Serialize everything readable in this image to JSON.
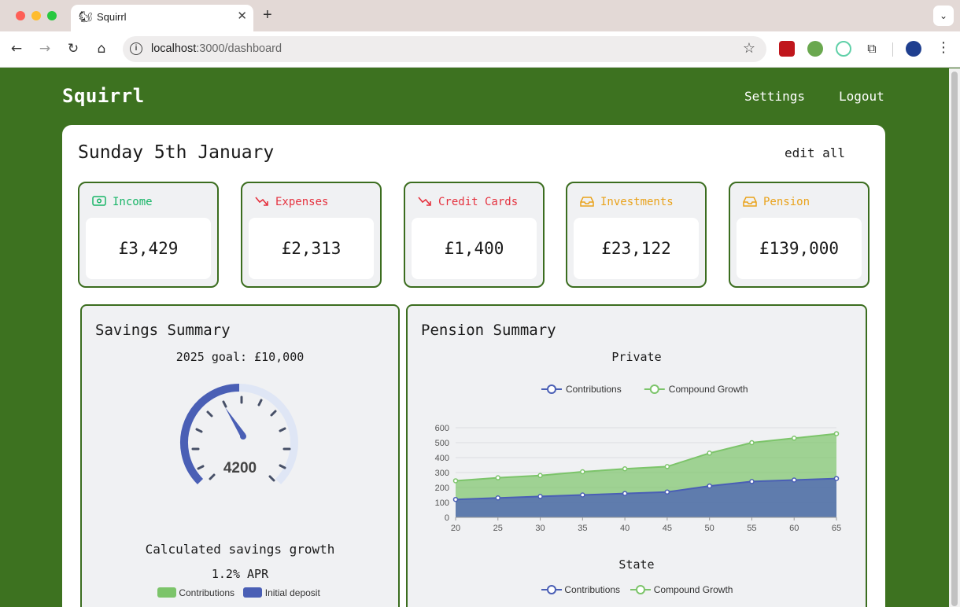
{
  "browser": {
    "tab_title": "Squirrl",
    "url_host": "localhost",
    "url_rest": ":3000/dashboard"
  },
  "app": {
    "brand": "Squirrl",
    "nav": [
      "Settings",
      "Logout"
    ],
    "date": "Sunday 5th January",
    "edit_all": "edit all"
  },
  "stats": [
    {
      "label": "Income",
      "value": "£3,429",
      "color": "#18b567",
      "icon": "cash-icon"
    },
    {
      "label": "Expenses",
      "value": "£2,313",
      "color": "#e5323f",
      "icon": "trend-down-icon"
    },
    {
      "label": "Credit Cards",
      "value": "£1,400",
      "color": "#e5323f",
      "icon": "trend-down-icon"
    },
    {
      "label": "Investments",
      "value": "£23,122",
      "color": "#e9a21b",
      "icon": "tray-icon"
    },
    {
      "label": "Pension",
      "value": "£139,000",
      "color": "#e9a21b",
      "icon": "tray-icon"
    }
  ],
  "savings": {
    "title": "Savings Summary",
    "goal": "2025 goal: £10,000",
    "gauge_value": "4200",
    "growth_title": "Calculated savings growth",
    "apr": "1.2% APR",
    "legend": [
      "Contributions",
      "Initial deposit"
    ]
  },
  "pension": {
    "title": "Pension Summary",
    "private_title": "Private",
    "state_title": "State",
    "legend": [
      "Contributions",
      "Compound Growth"
    ]
  },
  "chart_data": {
    "type": "area",
    "title": "Private",
    "x": [
      20,
      25,
      30,
      35,
      40,
      45,
      50,
      55,
      60,
      65
    ],
    "ylim": [
      0,
      600
    ],
    "yticks": [
      0,
      100,
      200,
      300,
      400,
      500,
      600
    ],
    "series": [
      {
        "name": "Contributions",
        "values": [
          120,
          130,
          140,
          150,
          160,
          170,
          210,
          240,
          250,
          260
        ],
        "color": "#4a5fb5"
      },
      {
        "name": "Compound Growth",
        "values": [
          245,
          265,
          280,
          305,
          325,
          340,
          430,
          500,
          530,
          560
        ],
        "color": "#7cc46a"
      }
    ],
    "legend_position": "top",
    "grid": true
  }
}
